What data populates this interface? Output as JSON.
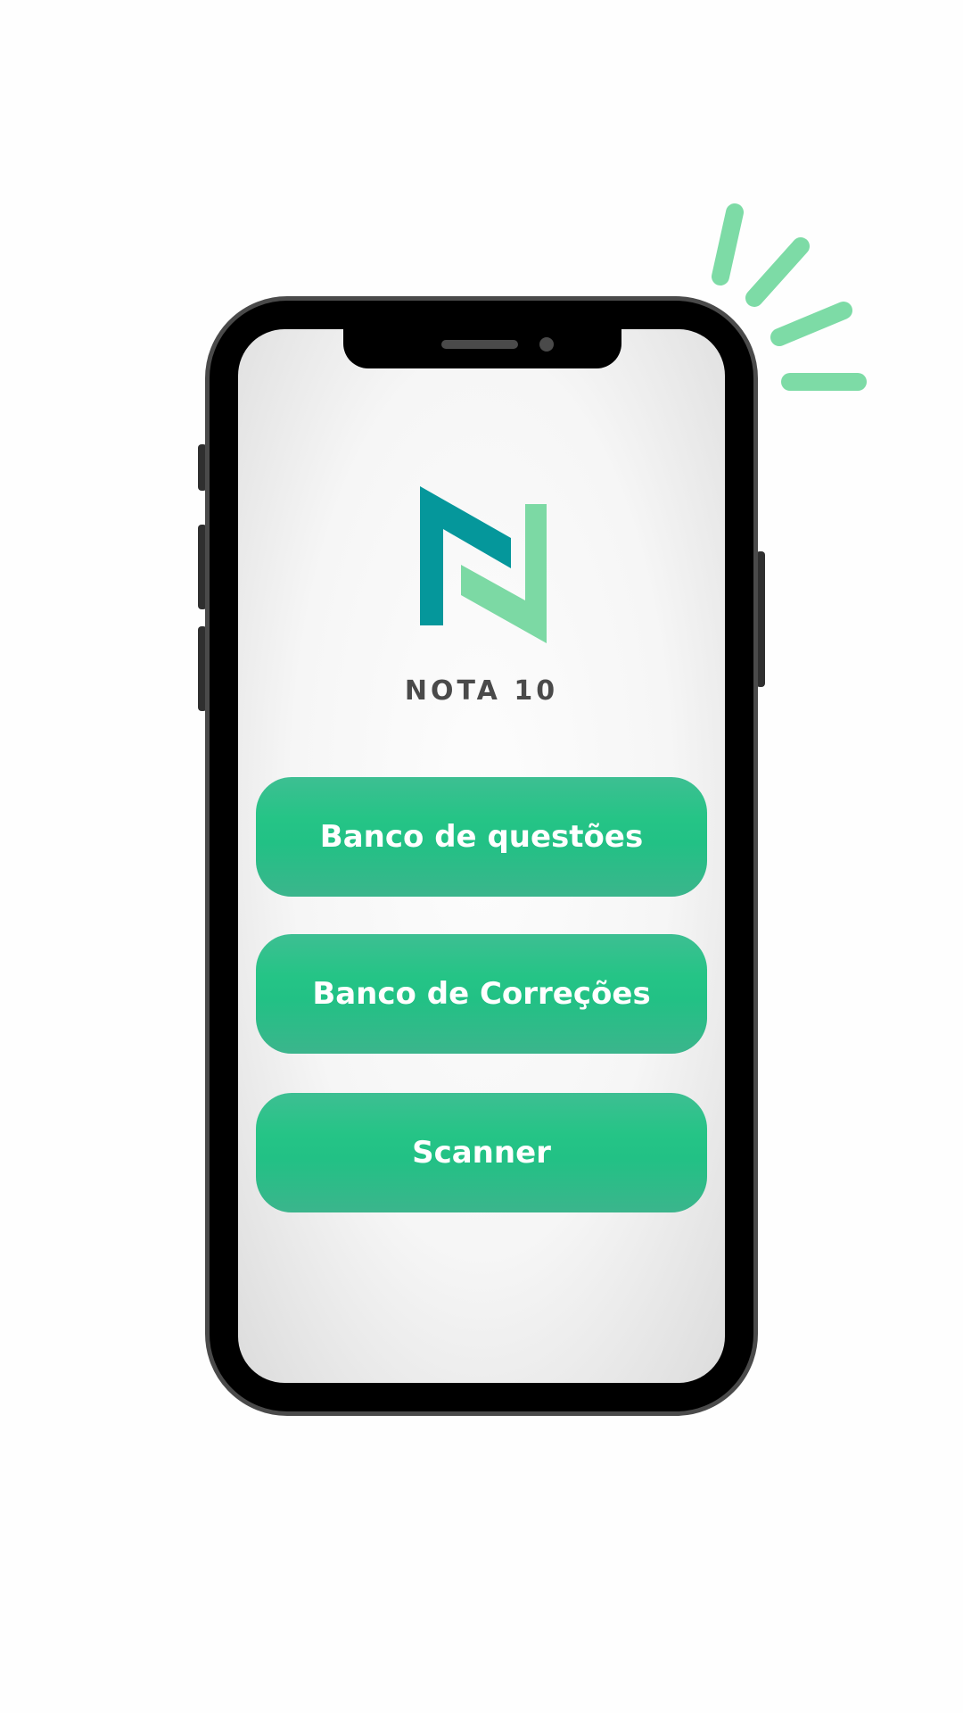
{
  "app": {
    "brand_name": "NOTA 10",
    "accent_color": "#25c486",
    "logo_dark_color": "#05979b",
    "logo_light_color": "#7cd9a4"
  },
  "menu": {
    "items": [
      {
        "label": "Banco de questões"
      },
      {
        "label": "Banco de Correções"
      },
      {
        "label": "Scanner"
      }
    ]
  },
  "icons": {
    "logo": "nota10-logo-icon",
    "decoration": "sparkle-lines-icon"
  }
}
